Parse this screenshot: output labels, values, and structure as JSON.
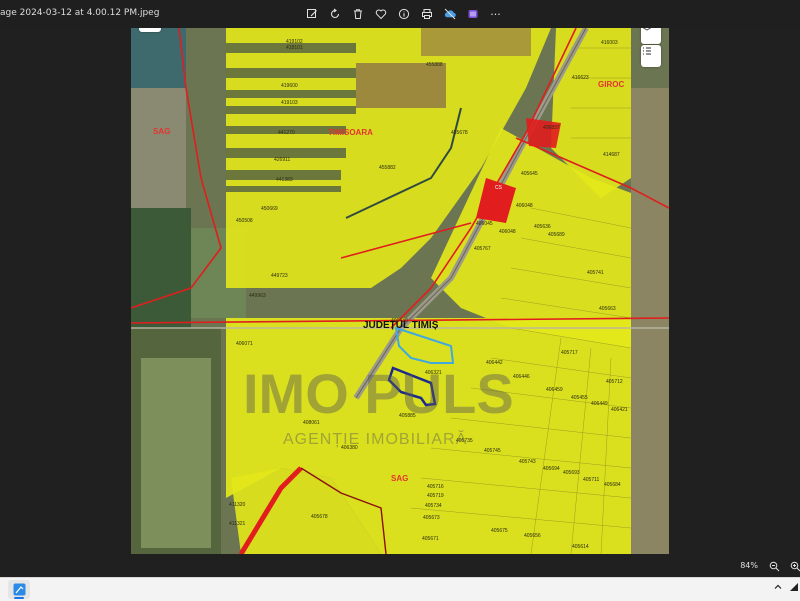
{
  "window": {
    "title": "age 2024-03-12 at 4.00.12 PM.jpeg"
  },
  "toolbar": {
    "icons": [
      "edit-icon",
      "rotate-icon",
      "delete-icon",
      "favorite-icon",
      "info-icon",
      "print-icon",
      "cloud-icon",
      "clipchamp-icon",
      "more-icon"
    ],
    "more_label": "···"
  },
  "map": {
    "parcels": [
      {
        "id": "p1",
        "text": "419102"
      },
      {
        "id": "p2",
        "text": "418101"
      },
      {
        "id": "p3",
        "text": "455888"
      },
      {
        "id": "p4",
        "text": "419600"
      },
      {
        "id": "p5",
        "text": "419103"
      },
      {
        "id": "p6",
        "text": "441270"
      },
      {
        "id": "p7",
        "text": "426911"
      },
      {
        "id": "p8",
        "text": "441383"
      },
      {
        "id": "p9",
        "text": "455678"
      },
      {
        "id": "p10",
        "text": "455882"
      },
      {
        "id": "p11",
        "text": "450669"
      },
      {
        "id": "p12",
        "text": "450508"
      },
      {
        "id": "p13",
        "text": "449723"
      },
      {
        "id": "p14",
        "text": "449963"
      },
      {
        "id": "p15",
        "text": "406071"
      },
      {
        "id": "p16",
        "text": "406430"
      },
      {
        "id": "p17",
        "text": "406321"
      },
      {
        "id": "p18",
        "text": "406442"
      },
      {
        "id": "p19",
        "text": "405717"
      },
      {
        "id": "p20",
        "text": "406446"
      },
      {
        "id": "p21",
        "text": "405712"
      },
      {
        "id": "p22",
        "text": "406459"
      },
      {
        "id": "p23",
        "text": "405455"
      },
      {
        "id": "p24",
        "text": "406449"
      },
      {
        "id": "p25",
        "text": "406421"
      },
      {
        "id": "p26",
        "text": "405885"
      },
      {
        "id": "p27",
        "text": "408061"
      },
      {
        "id": "p28",
        "text": "405735"
      },
      {
        "id": "p29",
        "text": "406380"
      },
      {
        "id": "p30",
        "text": "405745"
      },
      {
        "id": "p31",
        "text": "405743"
      },
      {
        "id": "p32",
        "text": "405694"
      },
      {
        "id": "p33",
        "text": "405693"
      },
      {
        "id": "p34",
        "text": "405711"
      },
      {
        "id": "p35",
        "text": "405684"
      },
      {
        "id": "p36",
        "text": "405716"
      },
      {
        "id": "p37",
        "text": "405719"
      },
      {
        "id": "p38",
        "text": "405734"
      },
      {
        "id": "p39",
        "text": "405673"
      },
      {
        "id": "p40",
        "text": "411320"
      },
      {
        "id": "p41",
        "text": "411321"
      },
      {
        "id": "p42",
        "text": "405678"
      },
      {
        "id": "p43",
        "text": "405675"
      },
      {
        "id": "p44",
        "text": "405656"
      },
      {
        "id": "p45",
        "text": "405671"
      },
      {
        "id": "p46",
        "text": "405614"
      },
      {
        "id": "p47",
        "text": "416003"
      },
      {
        "id": "p48",
        "text": "416623"
      },
      {
        "id": "p49",
        "text": "406837"
      },
      {
        "id": "p50",
        "text": "414687"
      },
      {
        "id": "p51",
        "text": "405645"
      },
      {
        "id": "p52",
        "text": "406048"
      },
      {
        "id": "p53",
        "text": "406045"
      },
      {
        "id": "p54",
        "text": "406048"
      },
      {
        "id": "p55",
        "text": "405636"
      },
      {
        "id": "p56",
        "text": "405689"
      },
      {
        "id": "p57",
        "text": "405767"
      },
      {
        "id": "p58",
        "text": "405741"
      },
      {
        "id": "p59",
        "text": "405663"
      },
      {
        "id": "p60",
        "text": "CS"
      }
    ],
    "places": {
      "sag_west": "SAG",
      "timisoara": "TIMISOARA",
      "giroc": "GIROC",
      "sag_south": "SAG"
    },
    "county_label": "JUDEȚUL TIMIȘ",
    "watermark": {
      "brand": "IMO PULS",
      "tagline": "AGENȚIE IMOBILIARĂ"
    },
    "colors": {
      "parcel_fill": "#e3e81a",
      "boundary": "#e11d1d",
      "subject_parcel": "#1c2a8c",
      "neighbor_parcel": "#3fa9e0"
    }
  },
  "status": {
    "zoom_label": "84%",
    "icons": [
      "zoom-out-icon",
      "zoom-in-icon"
    ]
  },
  "taskbar": {
    "app_icon": "photos-app-icon",
    "tray_icons": [
      "chevron-up-icon",
      "network-icon"
    ]
  }
}
